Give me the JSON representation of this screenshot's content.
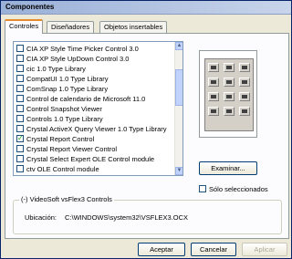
{
  "window": {
    "title": "Componentes"
  },
  "tabs": [
    {
      "label": "Controles"
    },
    {
      "label": "Diseñadores"
    },
    {
      "label": "Objetos insertables"
    }
  ],
  "list": {
    "items": [
      {
        "label": "CIA XP Style Time Picker Control 3.0",
        "checked": false
      },
      {
        "label": "CIA XP Style UpDown Control 3.0",
        "checked": false
      },
      {
        "label": "cic 1.0 Type Library",
        "checked": false
      },
      {
        "label": "CompatUI 1.0 Type Library",
        "checked": false
      },
      {
        "label": "ComSnap 1.0 Type Library",
        "checked": false
      },
      {
        "label": "Control de calendario de Microsoft 11.0",
        "checked": false
      },
      {
        "label": "Control Snapshot Viewer",
        "checked": false
      },
      {
        "label": "Controls 1.0 Type Library",
        "checked": false
      },
      {
        "label": "Crystal ActiveX Query Viewer 1.0 Type Library",
        "checked": false
      },
      {
        "label": "Crystal Report Control",
        "checked": true
      },
      {
        "label": "Crystal Report Viewer Control",
        "checked": false
      },
      {
        "label": "Crystal Select Expert OLE Control module",
        "checked": false
      },
      {
        "label": "ctv OLE Control module",
        "checked": false
      }
    ]
  },
  "buttons": {
    "examinar": "Examinar...",
    "aceptar": "Aceptar",
    "cancelar": "Cancelar",
    "aplicar": "Aplicar"
  },
  "options": {
    "solo_seleccionados": "Sólo seleccionados",
    "solo_checked": false
  },
  "details": {
    "group_title": "(-) VideoSoft vsFlex3 Controls",
    "location_label": "Ubicación:",
    "location_value": "C:\\WINDOWS\\system32\\VSFLEX3.OCX"
  },
  "colors": {
    "title_bar": "#9ab0d8",
    "panel_bg": "#ece9d8",
    "check_mark": "#21a121"
  }
}
